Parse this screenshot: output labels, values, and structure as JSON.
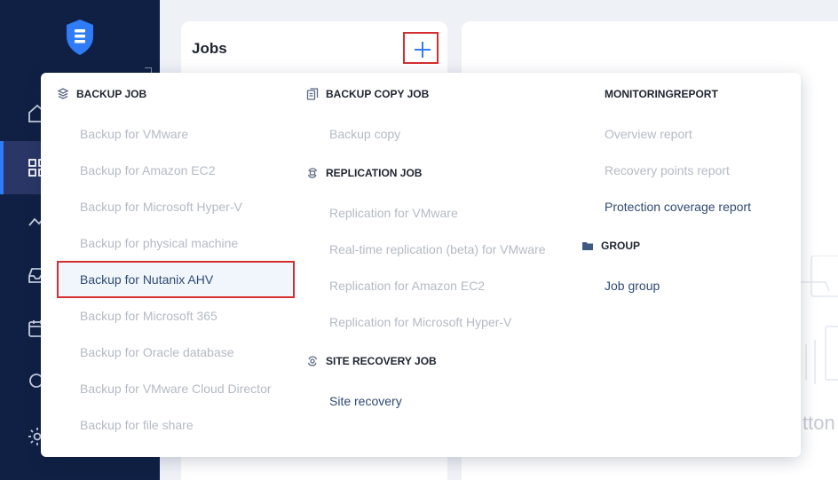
{
  "jobs": {
    "title": "Jobs"
  },
  "right_panel": {
    "partial_text": "tton"
  },
  "menu": {
    "backup_job": {
      "heading": "BACKUP JOB",
      "items": [
        "Backup for VMware",
        "Backup for Amazon EC2",
        "Backup for Microsoft Hyper-V",
        "Backup for physical machine",
        "Backup for Nutanix AHV",
        "Backup for Microsoft 365",
        "Backup for Oracle database",
        "Backup for VMware Cloud Director",
        "Backup for file share"
      ]
    },
    "backup_copy_job": {
      "heading": "BACKUP COPY JOB",
      "items": [
        "Backup copy"
      ]
    },
    "replication_job": {
      "heading": "REPLICATION JOB",
      "items": [
        "Replication for VMware",
        "Real-time replication (beta) for VMware",
        "Replication for Amazon EC2",
        "Replication for Microsoft Hyper-V"
      ]
    },
    "site_recovery_job": {
      "heading": "SITE RECOVERY JOB",
      "items": [
        "Site recovery"
      ]
    },
    "monitoring_report": {
      "heading": "MONITORINGREPORT",
      "items": [
        "Overview report",
        "Recovery points report",
        "Protection coverage report"
      ]
    },
    "group": {
      "heading": "GROUP",
      "items": [
        "Job group"
      ]
    }
  },
  "colors": {
    "sidebar": "#0f2044",
    "sidebar_active": "#2a3766",
    "accent": "#2f7cf6",
    "highlight_border": "#d32f2f",
    "item_enabled": "#2f4a73",
    "item_disabled": "#b4bac4"
  }
}
